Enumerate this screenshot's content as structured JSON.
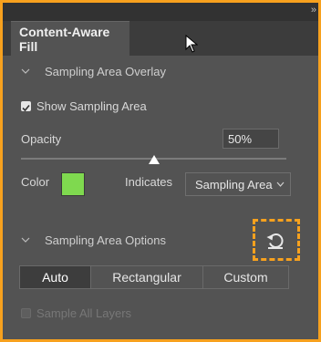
{
  "panel": {
    "tab_title": "Content-Aware Fill",
    "collapse_glyph": "»"
  },
  "overlay_section": {
    "title": "Sampling Area Overlay",
    "show_sampling_area": {
      "label": "Show Sampling Area",
      "checked": true
    },
    "opacity": {
      "label": "Opacity",
      "value": "50%",
      "slider_fraction": 0.5
    },
    "color": {
      "label": "Color",
      "swatch": "#7fd94f"
    },
    "indicates": {
      "label": "Indicates",
      "selected": "Sampling Area"
    }
  },
  "options_section": {
    "title": "Sampling Area Options",
    "reset_icon": "reset-icon",
    "modes": [
      {
        "label": "Auto",
        "active": true
      },
      {
        "label": "Rectangular",
        "active": false
      },
      {
        "label": "Custom",
        "active": false
      }
    ],
    "sample_all_layers": {
      "label": "Sample All Layers",
      "checked": false,
      "enabled": false
    }
  },
  "colors": {
    "highlight": "#f7a11e",
    "panel_bg": "#535353"
  }
}
